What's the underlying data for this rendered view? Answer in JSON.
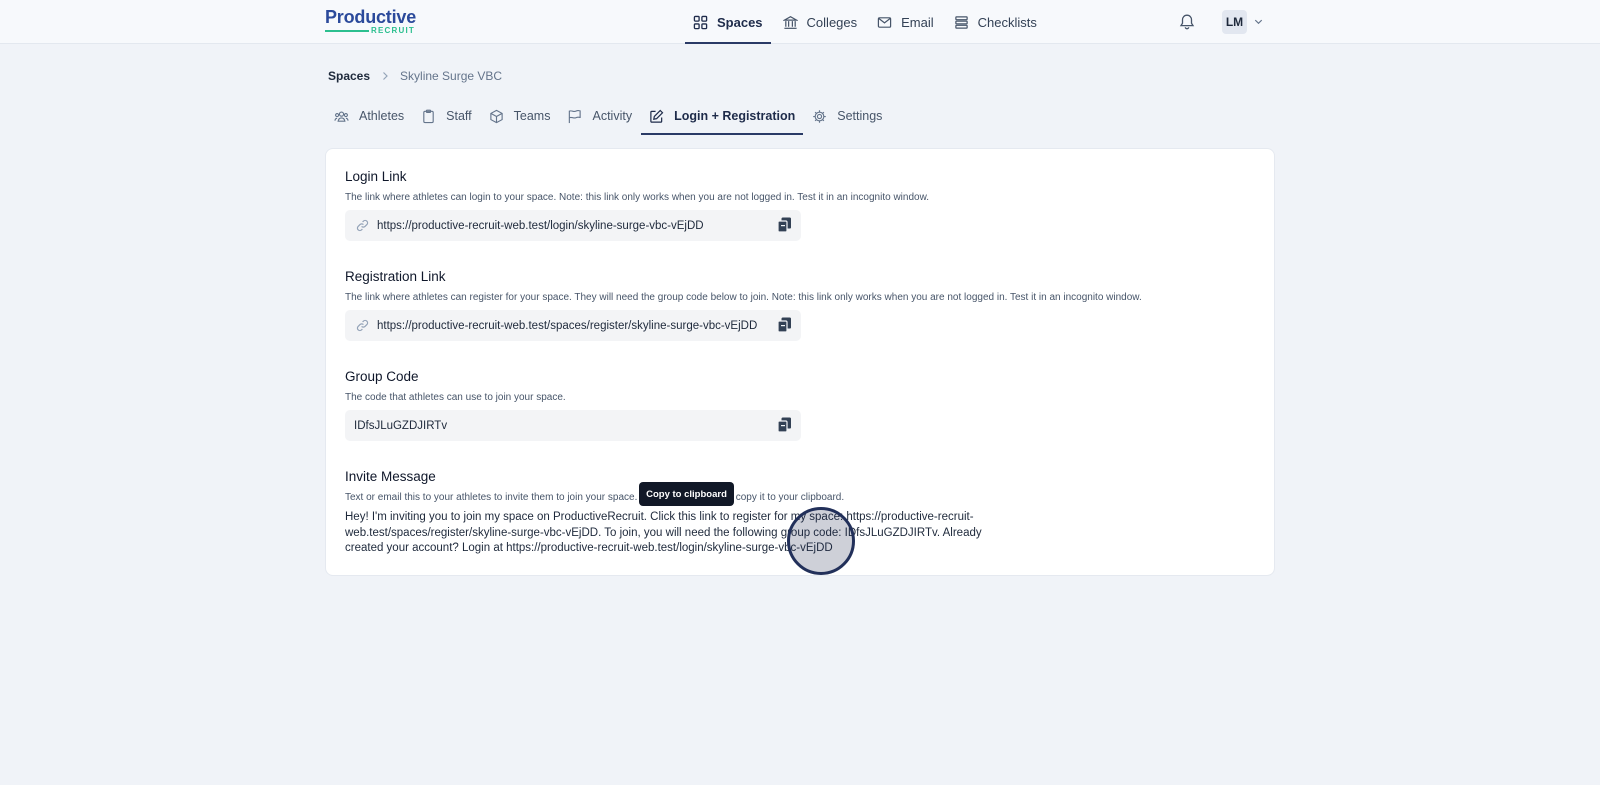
{
  "brand": {
    "name": "Productive",
    "sub": "RECRUIT"
  },
  "nav": {
    "items": [
      {
        "label": "Spaces",
        "icon": "grid-icon",
        "active": true
      },
      {
        "label": "Colleges",
        "icon": "building-columns-icon",
        "active": false
      },
      {
        "label": "Email",
        "icon": "envelope-icon",
        "active": false
      },
      {
        "label": "Checklists",
        "icon": "list-icon",
        "active": false
      }
    ]
  },
  "user": {
    "initials": "LM"
  },
  "breadcrumb": {
    "root": "Spaces",
    "current": "Skyline Surge VBC"
  },
  "tabs": [
    {
      "label": "Athletes",
      "icon": "users-icon",
      "active": false
    },
    {
      "label": "Staff",
      "icon": "clipboard-icon",
      "active": false
    },
    {
      "label": "Teams",
      "icon": "cube-icon",
      "active": false
    },
    {
      "label": "Activity",
      "icon": "flag-icon",
      "active": false
    },
    {
      "label": "Login + Registration",
      "icon": "pencil-square-icon",
      "active": true
    },
    {
      "label": "Settings",
      "icon": "gear-icon",
      "active": false
    }
  ],
  "login": {
    "title": "Login Link",
    "description": "The link where athletes can login to your space. Note: this link only works when you are not logged in. Test it in an incognito window.",
    "value": "https://productive-recruit-web.test/login/skyline-surge-vbc-vEjDD"
  },
  "registration": {
    "title": "Registration Link",
    "description": "The link where athletes can register for your space. They will need the group code below to join. Note: this link only works when you are not logged in. Test it in an incognito window.",
    "value": "https://productive-recruit-web.test/spaces/register/skyline-surge-vbc-vEjDD"
  },
  "group_code": {
    "title": "Group Code",
    "description": "The code that athletes can use to join your space.",
    "value": "IDfsJLuGZDJIRTv"
  },
  "invite": {
    "title": "Invite Message",
    "description": "Text or email this to your athletes to invite them to join your space. Click the message to copy it to your clipboard.",
    "message": "Hey! I'm inviting you to join my space on ProductiveRecruit. Click this link to register for my space: https://productive-recruit-web.test/spaces/register/skyline-surge-vbc-vEjDD. To join, you will need the following group code: IDfsJLuGZDJIRTv. Already created your account? Login at https://productive-recruit-web.test/login/skyline-surge-vbc-vEjDD"
  },
  "tooltip": "Copy to clipboard"
}
